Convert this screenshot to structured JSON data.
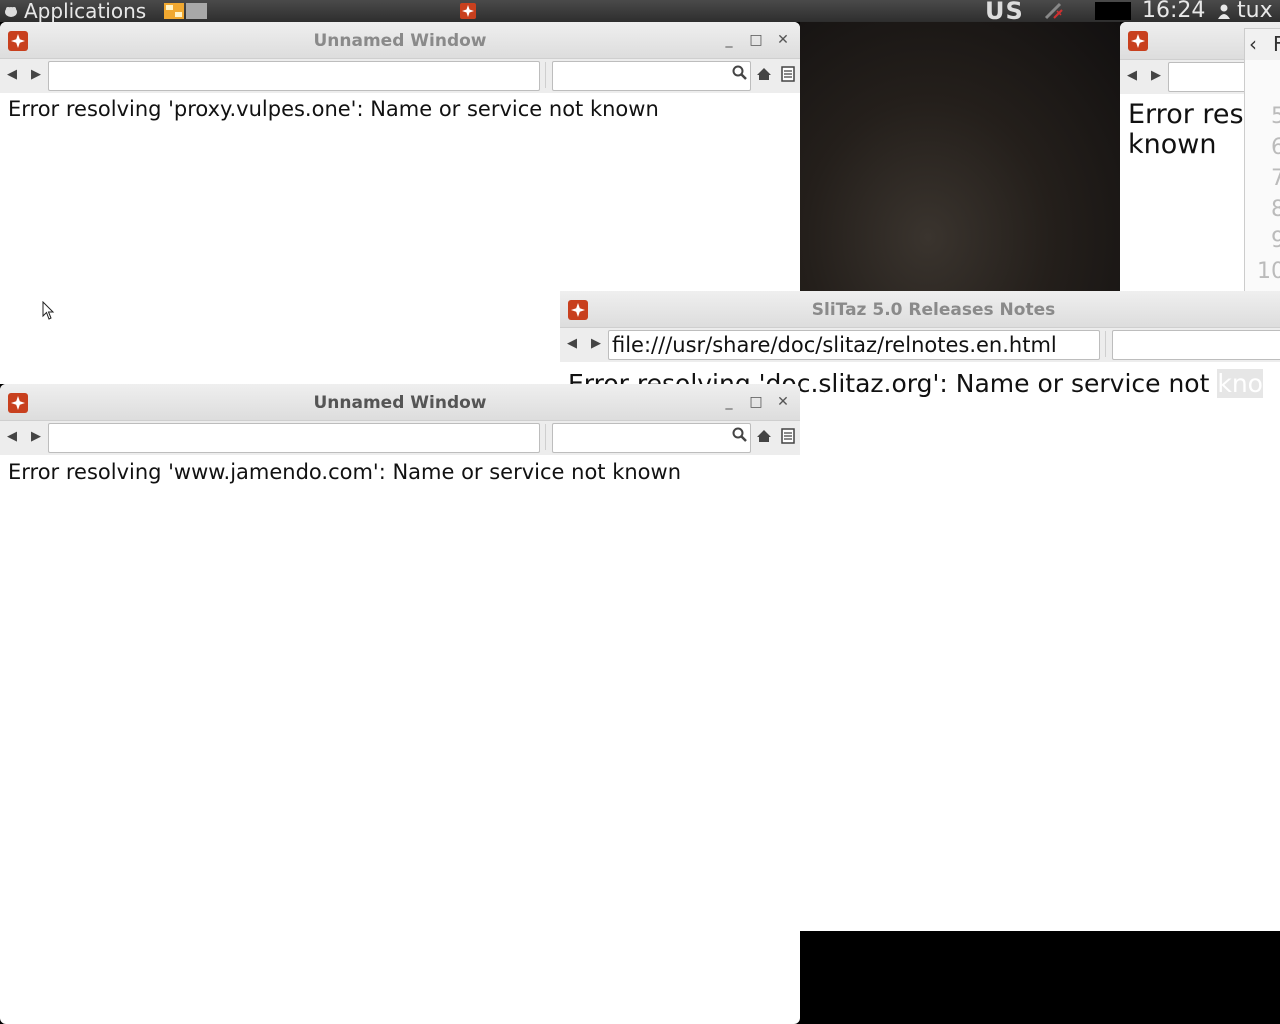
{
  "top_panel": {
    "menu_label": "Applications",
    "keyboard_layout": "US",
    "clock": "16:24",
    "user": "tux"
  },
  "windows": [
    {
      "title": "Unnamed Window",
      "url": "",
      "error": "Error resolving 'proxy.vulpes.one': Name or service not known"
    },
    {
      "title": "Unnamed Window",
      "url": "",
      "error": "Error resolving 'www.jamendo.com': Name or service not known"
    },
    {
      "title": "SliTaz 5.0 Releases Notes",
      "url": "file:///usr/share/doc/slitaz/relnotes.en.html",
      "error": "Error resolving 'doc.slitaz.org': Name or service not",
      "error_tail": "kno"
    },
    {
      "title_partial": "F",
      "error": "Error res known",
      "line_numbers": [
        "5",
        "6",
        "7",
        "8",
        "9",
        "10"
      ]
    }
  ],
  "colors": {
    "panel": "#3a3a3a",
    "titlebar": "#e6e6e6",
    "title_text": "#8a8a8a",
    "workspace_active": "#f0a830"
  }
}
